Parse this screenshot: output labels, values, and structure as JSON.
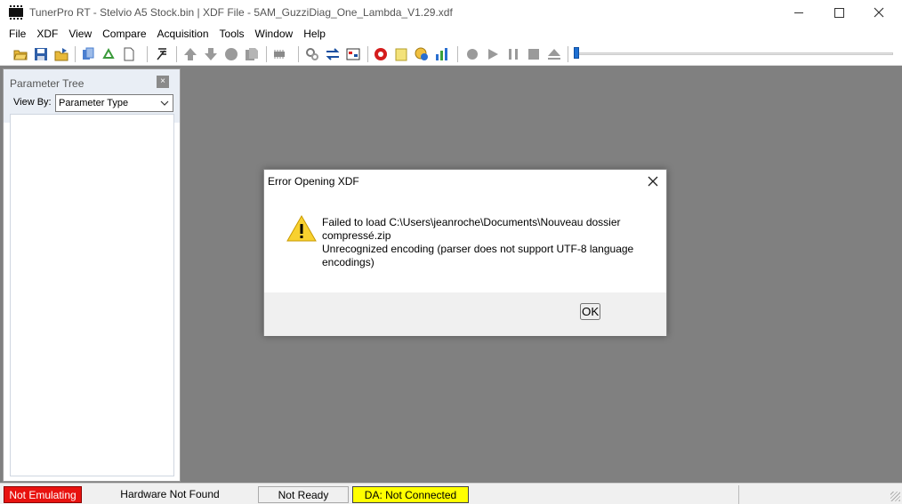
{
  "window": {
    "title": "TunerPro RT - Stelvio A5 Stock.bin | XDF File - 5AM_GuzziDiag_One_Lambda_V1.29.xdf"
  },
  "menu": {
    "items": [
      "File",
      "XDF",
      "View",
      "Compare",
      "Acquisition",
      "Tools",
      "Window",
      "Help"
    ]
  },
  "panel": {
    "title": "Parameter Tree",
    "close_glyph": "×",
    "view_by_label": "View By:",
    "view_by_value": "Parameter Type"
  },
  "dialog": {
    "title": "Error Opening XDF",
    "message_line1": "Failed to load C:\\Users\\jeanroche\\Documents\\Nouveau dossier compressé.zip",
    "message_line2": "Unrecognized encoding (parser does not support UTF-8 language encodings)",
    "ok_label": "OK"
  },
  "status": {
    "emulation": "Not Emulating",
    "hardware": "Hardware Not Found",
    "ready": "Not Ready",
    "da": "DA: Not Connected"
  },
  "colors": {
    "status_error": "#e8120f",
    "status_warning": "#ffff00",
    "workspace": "#808080",
    "accent": "#0078d7"
  },
  "icons": [
    "open-folder-icon",
    "save-icon",
    "save-as-icon",
    "load-xdf-icon",
    "recycle-icon",
    "new-document-icon",
    "tuning-fork-icon",
    "arrow-up-icon",
    "arrow-down-icon",
    "circle-icon",
    "copy-icon",
    "chip-icon",
    "gears-icon",
    "swap-icon",
    "hex-editor-icon",
    "record-red-icon",
    "notepad-icon",
    "globe-info-icon",
    "bar-chart-icon",
    "record-icon",
    "play-icon",
    "pause-icon",
    "stop-icon",
    "eject-icon"
  ]
}
